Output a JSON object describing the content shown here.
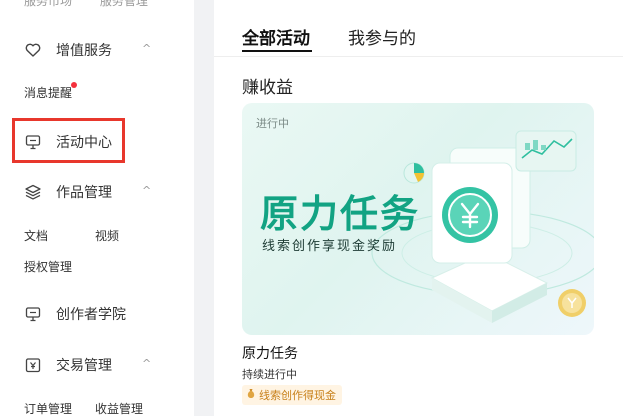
{
  "sidebar": {
    "top_items": [
      "服务市场",
      "服务管理"
    ],
    "value_services": {
      "label": "增值服务",
      "chevron": "^"
    },
    "message_reminder": {
      "label": "消息提醒"
    },
    "activity_center": {
      "label": "活动中心"
    },
    "works_management": {
      "label": "作品管理",
      "chevron": "^",
      "items": [
        "文档",
        "视频",
        "授权管理"
      ]
    },
    "creator_academy": {
      "label": "创作者学院"
    },
    "trade_management": {
      "label": "交易管理",
      "chevron": "^",
      "items": [
        "订单管理",
        "收益管理"
      ]
    }
  },
  "main": {
    "tabs": [
      {
        "label": "全部活动",
        "active": true
      },
      {
        "label": "我参与的",
        "active": false
      }
    ],
    "section_title": "赚收益",
    "card": {
      "status": "进行中",
      "title": "原力任务",
      "subtitle": "线索创作享现金奖励"
    },
    "task": {
      "name": "原力任务",
      "status": "持续进行中",
      "badge": "线索创作得现金"
    }
  },
  "colors": {
    "accent_green": "#12a383",
    "highlight_red": "#e8372c",
    "notification_dot": "#f5313d",
    "badge_text": "#c8811b",
    "badge_bg": "#fff4e3"
  }
}
